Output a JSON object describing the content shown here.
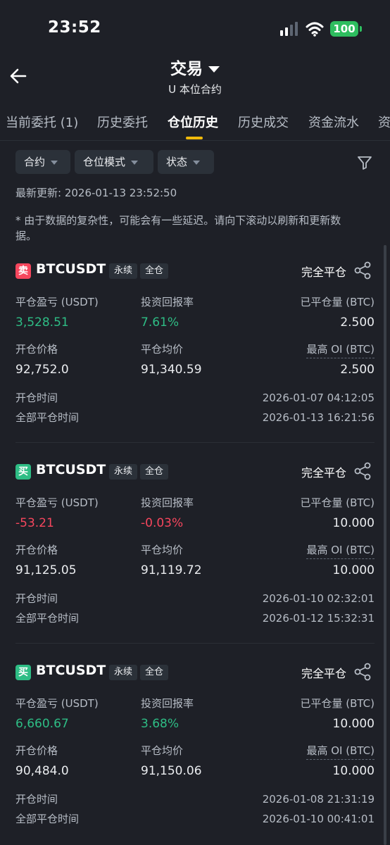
{
  "status_bar": {
    "time": "23:52",
    "battery": "100"
  },
  "header": {
    "title": "交易",
    "subtitle": "U 本位合约"
  },
  "tabs": [
    "当前委托 (1)",
    "历史委托",
    "仓位历史",
    "历史成交",
    "资金流水",
    "资"
  ],
  "active_tab": "仓位历史",
  "filters": [
    "合约",
    "仓位模式",
    "状态"
  ],
  "last_update": "最新更新: 2026-01-13 23:52:50",
  "notice": "* 由于数据的复杂性，可能会有一些延迟。请向下滚动以刷新和更新数据。",
  "labels": {
    "pnl": "平仓盈亏 (USDT)",
    "roi": "投资回报率",
    "closed_qty": "已平仓量 (BTC)",
    "open_price": "开仓价格",
    "avg_close_price": "平仓均价",
    "max_oi": "最高 OI (BTC)",
    "open_time": "开仓时间",
    "full_close_time": "全部平仓时间"
  },
  "positions": [
    {
      "side": "卖",
      "side_type": "sell",
      "symbol": "BTCUSDT",
      "tag_perp": "永续",
      "tag_margin": "全仓",
      "status": "完全平仓",
      "pnl": "3,528.51",
      "roi": "7.61%",
      "closed_qty": "2.500",
      "open_price": "92,752.0",
      "avg_close_price": "91,340.59",
      "max_oi": "2.500",
      "open_time": "2026-01-07 04:12:05",
      "full_close_time": "2026-01-13 16:21:56"
    },
    {
      "side": "买",
      "side_type": "buy",
      "symbol": "BTCUSDT",
      "tag_perp": "永续",
      "tag_margin": "全仓",
      "status": "完全平仓",
      "pnl": "-53.21",
      "roi": "-0.03%",
      "closed_qty": "10.000",
      "open_price": "91,125.05",
      "avg_close_price": "91,119.72",
      "max_oi": "10.000",
      "open_time": "2026-01-10 02:32:01",
      "full_close_time": "2026-01-12 15:32:31"
    },
    {
      "side": "买",
      "side_type": "buy",
      "symbol": "BTCUSDT",
      "tag_perp": "永续",
      "tag_margin": "全仓",
      "status": "完全平仓",
      "pnl": "6,660.67",
      "roi": "3.68%",
      "closed_qty": "10.000",
      "open_price": "90,484.0",
      "avg_close_price": "91,150.06",
      "max_oi": "10.000",
      "open_time": "2026-01-08 21:31:19",
      "full_close_time": "2026-01-10 00:41:01"
    }
  ],
  "colors": {
    "profit": "#2ebd85",
    "loss": "#f6465d",
    "accent": "#f0b90b",
    "background": "#1e2027"
  },
  "icons": [
    "back-arrow-icon",
    "caret-down-icon",
    "filter-funnel-icon",
    "share-icon",
    "wifi-icon",
    "signal-icon",
    "battery-icon"
  ]
}
